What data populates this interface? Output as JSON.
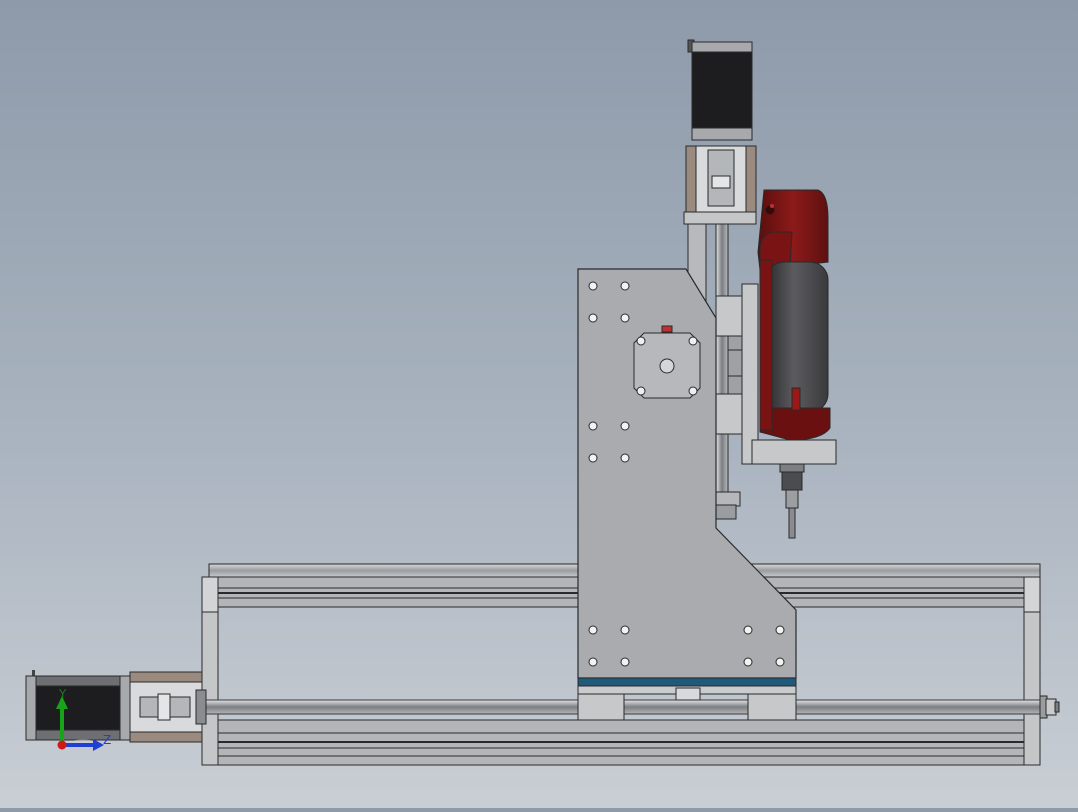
{
  "scene": {
    "view_type": "cad-3d-model-side-view",
    "model": "cnc-router-gantry-assembly"
  },
  "triad": {
    "y_label": "Y",
    "z_label": "Z",
    "y_color": "#19a319",
    "z_color": "#1f3fd6",
    "origin_color": "#d01818"
  },
  "colors": {
    "background_top": "#8e9aaa",
    "background_bottom": "#c9ced4",
    "aluminum": "#a9abae",
    "motor_body": "#1d1d1f",
    "spindle_red": "#7a1414",
    "spindle_gray": "#4a4a4c",
    "blue_strip": "#1f5a7a"
  }
}
